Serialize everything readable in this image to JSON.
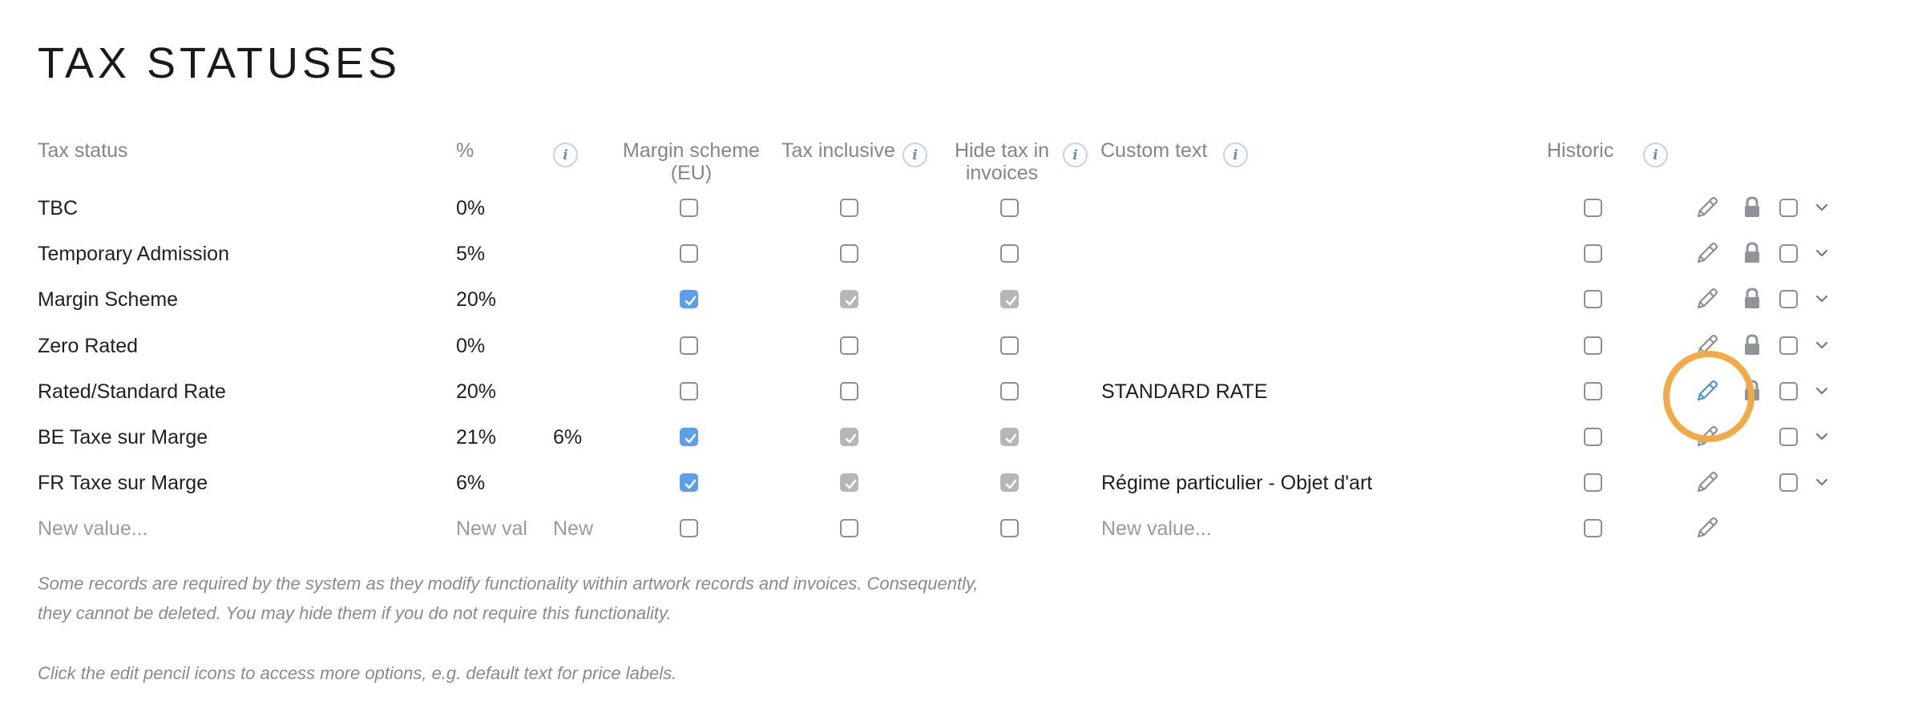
{
  "page": {
    "title": "TAX STATUSES"
  },
  "columns": {
    "tax_status": "Tax status",
    "percent": "%",
    "margin_scheme": "Margin scheme (EU)",
    "tax_inclusive": "Tax inclusive",
    "hide_tax": "Hide tax in invoices",
    "custom_text": "Custom text",
    "historic": "Historic"
  },
  "rows": [
    {
      "name": "TBC",
      "percent": "0%",
      "alt": "",
      "margin": false,
      "inclusive": false,
      "hide": false,
      "custom": "",
      "historic": false,
      "locked": true,
      "has_select": true
    },
    {
      "name": "Temporary Admission",
      "percent": "5%",
      "alt": "",
      "margin": false,
      "inclusive": false,
      "hide": false,
      "custom": "",
      "historic": false,
      "locked": true,
      "has_select": true
    },
    {
      "name": "Margin Scheme",
      "percent": "20%",
      "alt": "",
      "margin": true,
      "inclusive": true,
      "hide": true,
      "custom": "",
      "historic": false,
      "locked": true,
      "has_select": true
    },
    {
      "name": "Zero Rated",
      "percent": "0%",
      "alt": "",
      "margin": false,
      "inclusive": false,
      "hide": false,
      "custom": "",
      "historic": false,
      "locked": true,
      "has_select": true
    },
    {
      "name": "Rated/Standard Rate",
      "percent": "20%",
      "alt": "",
      "margin": false,
      "inclusive": false,
      "hide": false,
      "custom": "STANDARD RATE",
      "historic": false,
      "locked": true,
      "has_select": true
    },
    {
      "name": "BE Taxe sur Marge",
      "percent": "21%",
      "alt": "6%",
      "margin": true,
      "inclusive": true,
      "hide": true,
      "custom": "",
      "historic": false,
      "locked": false,
      "has_select": true
    },
    {
      "name": "FR Taxe sur Marge",
      "percent": "6%",
      "alt": "",
      "margin": true,
      "inclusive": true,
      "hide": true,
      "custom": "Régime particulier - Objet d'art",
      "historic": false,
      "locked": false,
      "has_select": true
    }
  ],
  "new_row": {
    "name_placeholder": "New value...",
    "percent_placeholder": "New val",
    "alt_placeholder": "New",
    "custom_placeholder": "New value..."
  },
  "notes": {
    "line1": "Some records are required by the system as they modify functionality within artwork records and invoices. Consequently,",
    "line2": "they cannot be deleted. You may hide them if you do not require this functionality.",
    "line3": "Click the edit pencil icons to access more options, e.g. default text for price labels."
  },
  "colors": {
    "checked_primary": "#5b9fea",
    "checked_secondary": "#b6b6b6",
    "highlight": "#f2aa46",
    "info_icon": "#6d8bb4"
  },
  "icons": {
    "edit": "pencil-icon",
    "lock": "lock-icon",
    "expand": "chevron-down-icon",
    "info": "info-icon"
  }
}
